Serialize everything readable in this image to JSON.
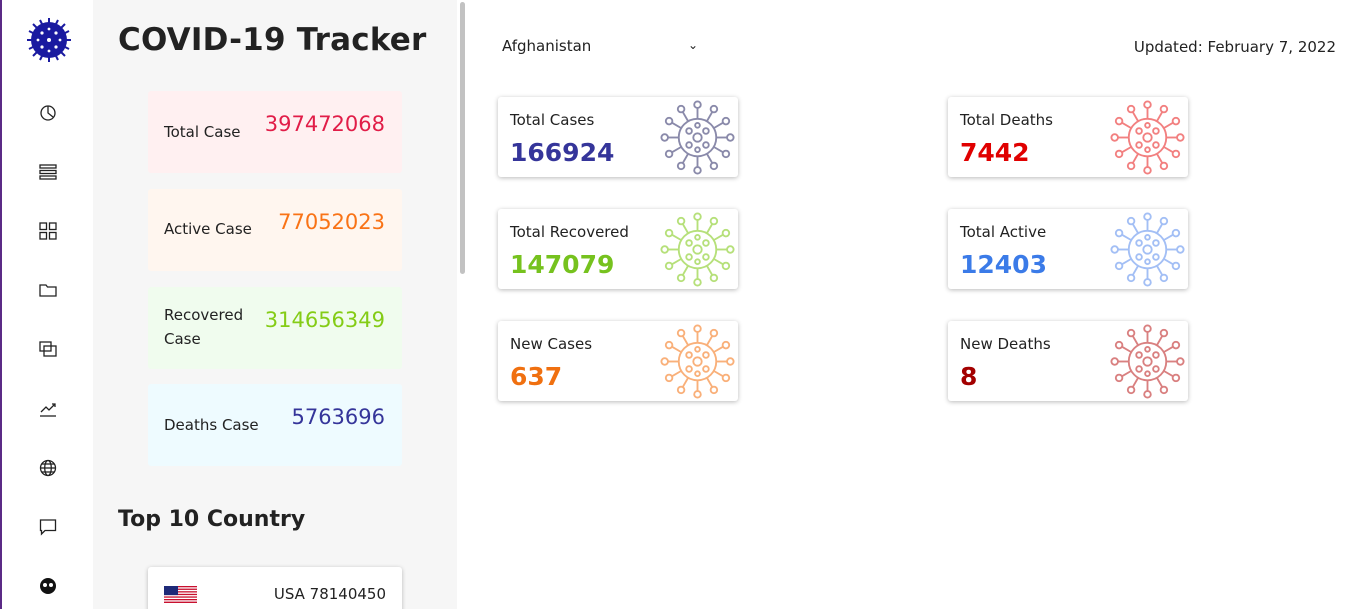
{
  "app": {
    "title": "COVID-19 Tracker"
  },
  "rail": {
    "icons": [
      "pie-chart-icon",
      "list-icon",
      "grid-icon",
      "folder-icon",
      "copy-icon",
      "trend-icon",
      "globe-icon",
      "chat-icon",
      "emoji-icon"
    ]
  },
  "summary": {
    "total": {
      "label": "Total Case",
      "value": "397472068",
      "color": "#e11d48",
      "bg": "#fff0f1"
    },
    "active": {
      "label": "Active Case",
      "value": "77052023",
      "color": "#f97316",
      "bg": "#fff6ef"
    },
    "recovered": {
      "label": "Recovered Case",
      "value": "314656349",
      "color": "#84cc16",
      "bg": "#f0fcee"
    },
    "deaths": {
      "label": "Deaths Case",
      "value": "5763696",
      "color": "#35359a",
      "bg": "#eefbff"
    }
  },
  "top10": {
    "title": "Top 10 Country",
    "items": [
      {
        "name": "USA 78140450"
      }
    ]
  },
  "main": {
    "country_selected": "Afghanistan",
    "updated": "Updated: February 7, 2022"
  },
  "cards": {
    "total_cases": {
      "label": "Total Cases",
      "value": "166924",
      "color": "#35359a",
      "icon_color": "#8a8aaa"
    },
    "total_deaths": {
      "label": "Total Deaths",
      "value": "7442",
      "color": "#e00000",
      "icon_color": "#f28080"
    },
    "total_recovered": {
      "label": "Total Recovered",
      "value": "147079",
      "color": "#76c21e",
      "icon_color": "#b6e07a"
    },
    "total_active": {
      "label": "Total Active",
      "value": "12403",
      "color": "#3b7be8",
      "icon_color": "#a3bff5"
    },
    "new_cases": {
      "label": "New Cases",
      "value": "637",
      "color": "#f07010",
      "icon_color": "#f9b07a"
    },
    "new_deaths": {
      "label": "New Deaths",
      "value": "8",
      "color": "#a30000",
      "icon_color": "#d98080"
    }
  }
}
